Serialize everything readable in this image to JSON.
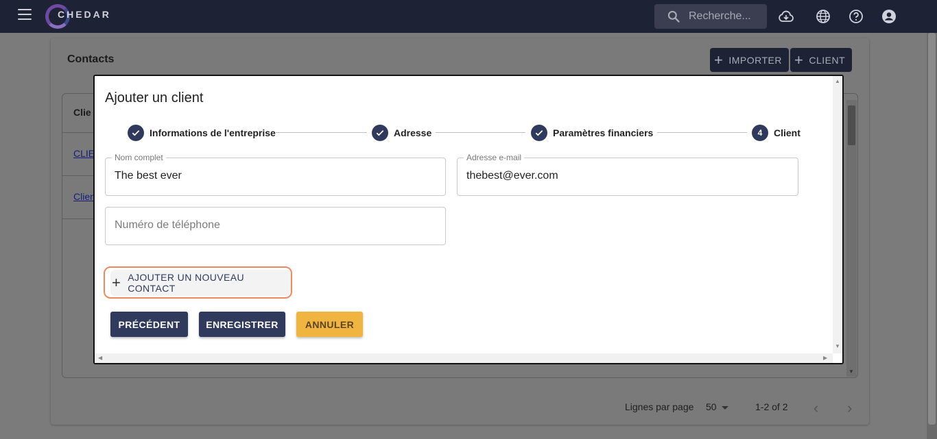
{
  "app": {
    "logo_text": "CHEDAR",
    "search_placeholder": "Recherche...",
    "icons": [
      "menu-icon",
      "cloud-download-icon",
      "globe-icon",
      "help-icon",
      "account-icon"
    ]
  },
  "background": {
    "title": "Contacts",
    "import_label": "IMPORTER",
    "client_label": "CLIENT",
    "table_header": "Clie",
    "rows": [
      "CLIE",
      "Clien"
    ],
    "pagination": {
      "rows_per_page_label": "Lignes par page",
      "rows_per_page": "50",
      "range": "1-2 of 2"
    }
  },
  "dialog": {
    "title": "Ajouter un client",
    "steps": [
      {
        "label": "Informations de l'entreprise",
        "done": true
      },
      {
        "label": "Adresse",
        "done": true
      },
      {
        "label": "Paramètres financiers",
        "done": true
      },
      {
        "label": "Client",
        "number": "4",
        "done": false
      }
    ],
    "fields": {
      "full_name": {
        "label": "Nom complet",
        "value": "The best ever"
      },
      "email": {
        "label": "Adresse e-mail",
        "value": "thebest@ever.com"
      },
      "phone": {
        "placeholder": "Numéro de téléphone"
      }
    },
    "add_contact_label": "AJOUTER UN NOUVEAU CONTACT",
    "buttons": {
      "previous": "PRÉCÉDENT",
      "save": "ENREGISTRER",
      "cancel": "ANNULER"
    }
  },
  "colors": {
    "primary": "#303a5c",
    "appbar": "#1e2235",
    "accent": "#f0b440",
    "highlight": "#f08a5d"
  }
}
